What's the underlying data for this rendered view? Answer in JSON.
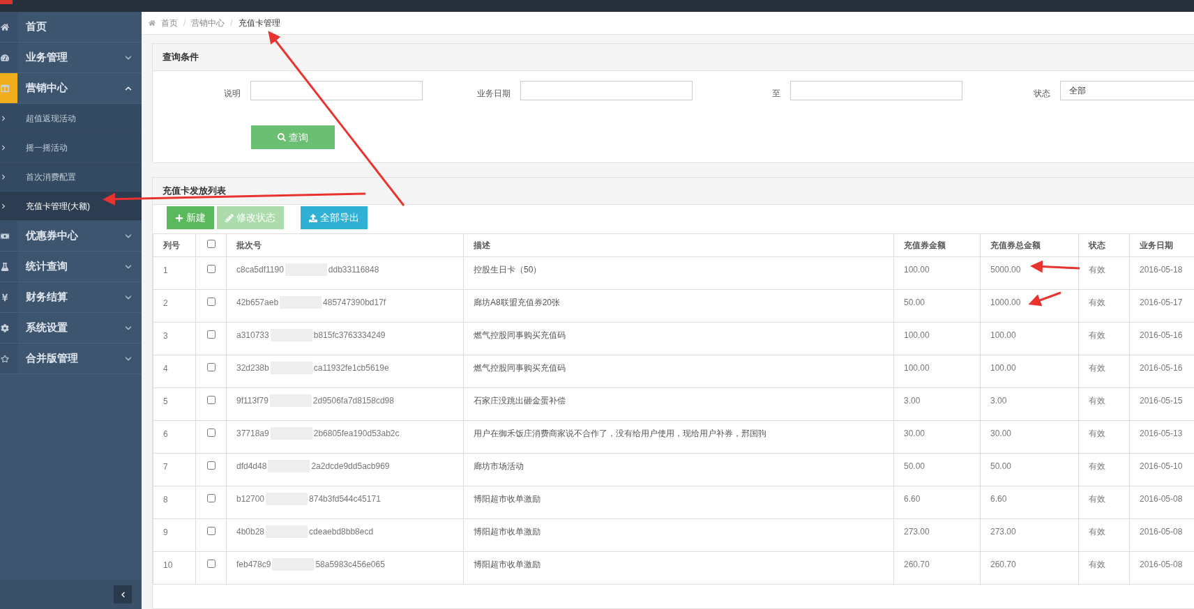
{
  "sidebar": {
    "items": [
      {
        "label": "首页",
        "selected": false
      },
      {
        "label": "业务管理",
        "selected": false,
        "expanded": false
      },
      {
        "label": "营销中心",
        "selected": true,
        "expanded": true,
        "children": [
          {
            "label": "超值返现活动",
            "selected": false
          },
          {
            "label": "摇一摇活动",
            "selected": false
          },
          {
            "label": "首次消费配置",
            "selected": false
          },
          {
            "label": "充值卡管理(大额)",
            "selected": true
          }
        ]
      },
      {
        "label": "优惠券中心",
        "selected": false,
        "expanded": false
      },
      {
        "label": "统计查询",
        "selected": false,
        "expanded": false
      },
      {
        "label": "财务结算",
        "selected": false,
        "expanded": false
      },
      {
        "label": "系统设置",
        "selected": false,
        "expanded": false
      },
      {
        "label": "合并版管理",
        "selected": false,
        "expanded": false
      }
    ]
  },
  "breadcrumb": [
    {
      "label": "首页"
    },
    {
      "separator": "/",
      "label": "营销中心"
    },
    {
      "separator": "/",
      "label": "充值卡管理"
    }
  ],
  "query_panel": {
    "title": "查询条件",
    "fields": [
      {
        "label": "说明",
        "kind": "input"
      },
      {
        "label": "业务日期",
        "kind": "input"
      },
      {
        "label": "至",
        "kind": "input"
      },
      {
        "label": "状态",
        "kind": "select",
        "value": "全部"
      }
    ],
    "button": "查询"
  },
  "list_panel": {
    "title": "充值卡发放列表",
    "buttons": [
      {
        "label": "新建",
        "kind": "success",
        "disabled": false
      },
      {
        "label": "修改状态",
        "kind": "success",
        "disabled": true
      },
      {
        "label": "全部导出",
        "kind": "info",
        "disabled": false
      }
    ],
    "table": {
      "columns": [
        "列号",
        "",
        "批次号",
        "描述",
        "充值券金额",
        "充值券总金额",
        "状态",
        "业务日期"
      ],
      "select_all_checked": false,
      "rows": [
        {
          "no": "1",
          "checked": false,
          "batch_start": "c8ca5df1190",
          "batch_end": "ddb33116848",
          "description": "控股生日卡（50）",
          "amount": "100.00",
          "total": "5000.00",
          "status": "有效",
          "date": "2016-05-18"
        },
        {
          "no": "2",
          "checked": false,
          "batch_start": "42b657aeb",
          "batch_end": "485747390bd17f",
          "description": "廊坊A8联盟充值券20张",
          "amount": "50.00",
          "total": "1000.00",
          "status": "有效",
          "date": "2016-05-17"
        },
        {
          "no": "3",
          "checked": false,
          "batch_start": "a310733",
          "batch_end": "b815fc3763334249",
          "description": "燃气控股同事购买充值码",
          "amount": "100.00",
          "total": "100.00",
          "status": "有效",
          "date": "2016-05-16"
        },
        {
          "no": "4",
          "checked": false,
          "batch_start": "32d238b",
          "batch_end": "ca11932fe1cb5619e",
          "description": "燃气控股同事购买充值码",
          "amount": "100.00",
          "total": "100.00",
          "status": "有效",
          "date": "2016-05-16"
        },
        {
          "no": "5",
          "checked": false,
          "batch_start": "9f113f79",
          "batch_end": "2d9506fa7d8158cd98",
          "description": "石家庄没跳出砸金蛋补偿",
          "amount": "3.00",
          "total": "3.00",
          "status": "有效",
          "date": "2016-05-15"
        },
        {
          "no": "6",
          "checked": false,
          "batch_start": "37718a9",
          "batch_end": "2b6805fea190d53ab2c",
          "description": "用户在御禾饭庄消费商家说不合作了，没有给用户使用，现给用户补券，邢国驹",
          "amount": "30.00",
          "total": "30.00",
          "status": "有效",
          "date": "2016-05-13"
        },
        {
          "no": "7",
          "checked": false,
          "batch_start": "dfd4d48",
          "batch_end": "2a2dcde9dd5acb969",
          "description": "廊坊市场活动",
          "amount": "50.00",
          "total": "50.00",
          "status": "有效",
          "date": "2016-05-10"
        },
        {
          "no": "8",
          "checked": false,
          "batch_start": "b12700",
          "batch_end": "874b3fd544c45171",
          "description": "博阳超市收单激励",
          "amount": "6.60",
          "total": "6.60",
          "status": "有效",
          "date": "2016-05-08"
        },
        {
          "no": "9",
          "checked": false,
          "batch_start": "4b0b28",
          "batch_end": "cdeaebd8bb8ecd",
          "description": "博阳超市收单激励",
          "amount": "273.00",
          "total": "273.00",
          "status": "有效",
          "date": "2016-05-08"
        },
        {
          "no": "10",
          "checked": false,
          "batch_start": "feb478c9",
          "batch_end": "58a5983c456e065",
          "description": "博阳超市收单激励",
          "amount": "260.70",
          "total": "260.70",
          "status": "有效",
          "date": "2016-05-08"
        }
      ]
    }
  }
}
